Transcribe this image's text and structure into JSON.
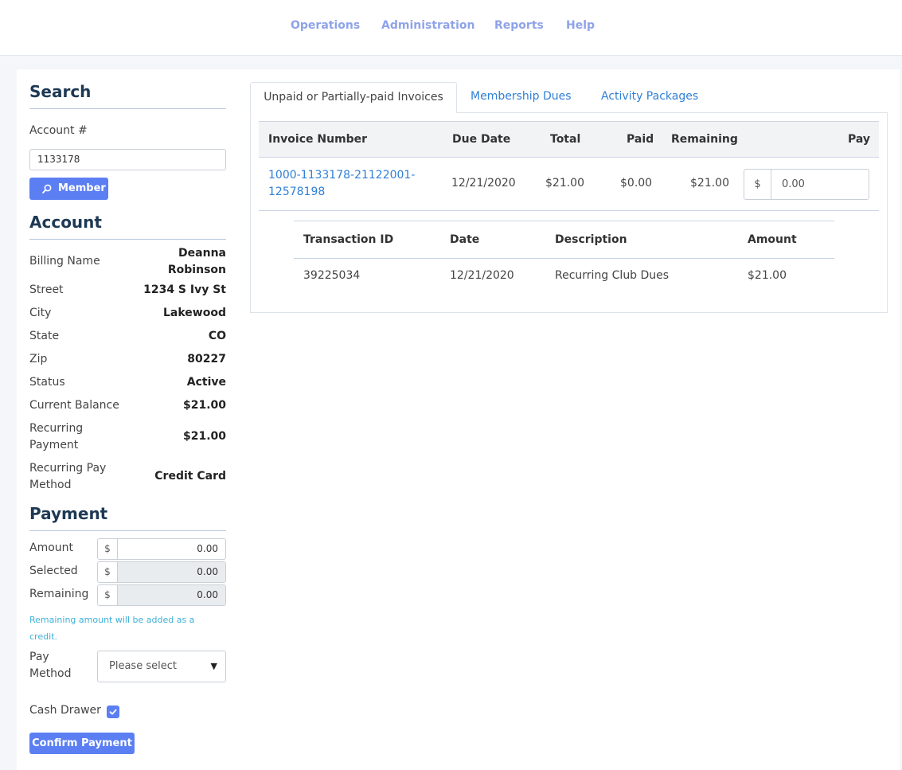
{
  "nav": {
    "items": [
      "Operations",
      "Administration",
      "Reports",
      "Help"
    ],
    "color": "#8fa3e8"
  },
  "search": {
    "title": "Search",
    "account_label": "Account #",
    "account_value": "1133178",
    "member_button": "Member"
  },
  "account": {
    "title": "Account",
    "billing_name_label": "Billing Name",
    "billing_name_line1": "Deanna",
    "billing_name_line2": "Robinson",
    "street_label": "Street",
    "street": "1234 S Ivy St",
    "city_label": "City",
    "city": "Lakewood",
    "state_label": "State",
    "state": "CO",
    "zip_label": "Zip",
    "zip": "80227",
    "status_label": "Status",
    "status": "Active",
    "current_balance_label": "Current Balance",
    "current_balance": "$21.00",
    "recurring_payment_label_1": "Recurring",
    "recurring_payment_label_2": "Payment",
    "recurring_payment": "$21.00",
    "recurring_method_label_1": "Recurring Pay",
    "recurring_method_label_2": "Method",
    "recurring_method": "Credit Card"
  },
  "payment": {
    "title": "Payment",
    "currency": "$",
    "amount_label": "Amount",
    "amount": "0.00",
    "selected_label": "Selected",
    "selected": "0.00",
    "remaining_label": "Remaining",
    "remaining": "0.00",
    "help_text": "Remaining amount will be added as a credit.",
    "pay_method_label_1": "Pay",
    "pay_method_label_2": "Method",
    "pay_method_placeholder": "Please select",
    "cash_drawer_label": "Cash Drawer",
    "cash_drawer_checked": true,
    "confirm_button": "Confirm Payment"
  },
  "tabs": {
    "active": "Unpaid or Partially-paid Invoices",
    "membership_dues": "Membership Dues",
    "activity_packages": "Activity Packages"
  },
  "invoices": {
    "headers": {
      "invoice_number": "Invoice Number",
      "due_date": "Due Date",
      "total": "Total",
      "paid": "Paid",
      "remaining": "Remaining",
      "pay": "Pay"
    },
    "rows": [
      {
        "invoice_number_line1": "1000-1133178-21122001-",
        "invoice_number_line2": "12578198",
        "due_date": "12/21/2020",
        "total": "$21.00",
        "paid": "$0.00",
        "remaining": "$21.00",
        "pay_currency": "$",
        "pay_value": "0.00"
      }
    ]
  },
  "transactions": {
    "headers": {
      "transaction_id": "Transaction ID",
      "date": "Date",
      "description": "Description",
      "amount": "Amount"
    },
    "rows": [
      {
        "transaction_id": "39225034",
        "date": "12/21/2020",
        "description": "Recurring Club Dues",
        "amount": "$21.00"
      }
    ]
  }
}
